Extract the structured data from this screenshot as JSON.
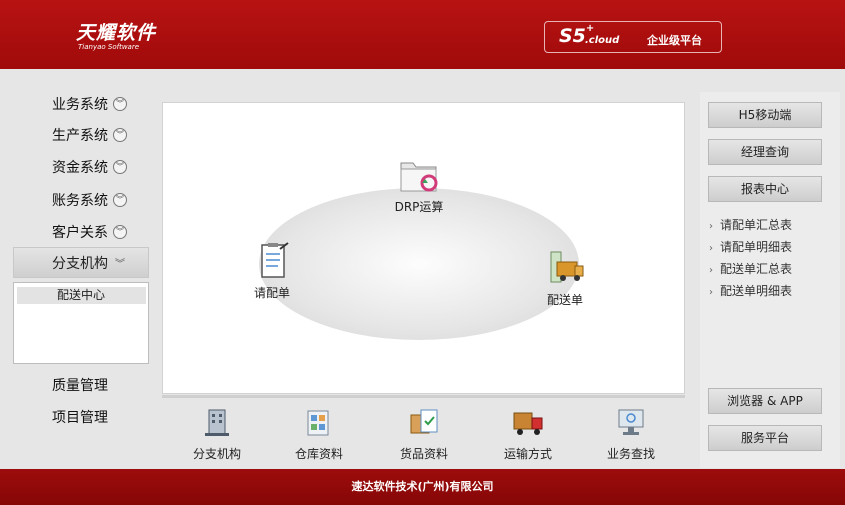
{
  "header": {
    "logo_cn": "天耀软件",
    "logo_en": "Tianyao Software",
    "brand_main": "S5",
    "brand_sup": "+",
    "brand_cloud": ".cloud",
    "platform_label": "企业级平台"
  },
  "nav": {
    "items": [
      {
        "label": "业务系统"
      },
      {
        "label": "生产系统"
      },
      {
        "label": "资金系统"
      },
      {
        "label": "账务系统"
      },
      {
        "label": "客户关系"
      }
    ],
    "active": {
      "label": "分支机构"
    },
    "sub_items": [
      "配送中心"
    ],
    "bottom_items": [
      {
        "label": "质量管理"
      },
      {
        "label": "项目管理"
      }
    ]
  },
  "flow": {
    "drp": "DRP运算",
    "request": "请配单",
    "delivery": "配送单"
  },
  "bottom_icons": [
    {
      "label": "分支机构",
      "icon": "building-icon"
    },
    {
      "label": "仓库资料",
      "icon": "warehouse-icon"
    },
    {
      "label": "货品资料",
      "icon": "goods-icon"
    },
    {
      "label": "运输方式",
      "icon": "truck-icon"
    },
    {
      "label": "业务查找",
      "icon": "monitor-icon"
    }
  ],
  "right": {
    "buttons_top": [
      "H5移动端",
      "经理查询",
      "报表中心"
    ],
    "links": [
      "请配单汇总表",
      "请配单明细表",
      "配送单汇总表",
      "配送单明细表"
    ],
    "buttons_bottom": [
      "浏览器 & APP",
      "服务平台"
    ]
  },
  "footer": {
    "company": "速达软件技术(广州)有限公司"
  },
  "colors": {
    "brand_red": "#b81313",
    "footer_red": "#9d0c0c"
  }
}
